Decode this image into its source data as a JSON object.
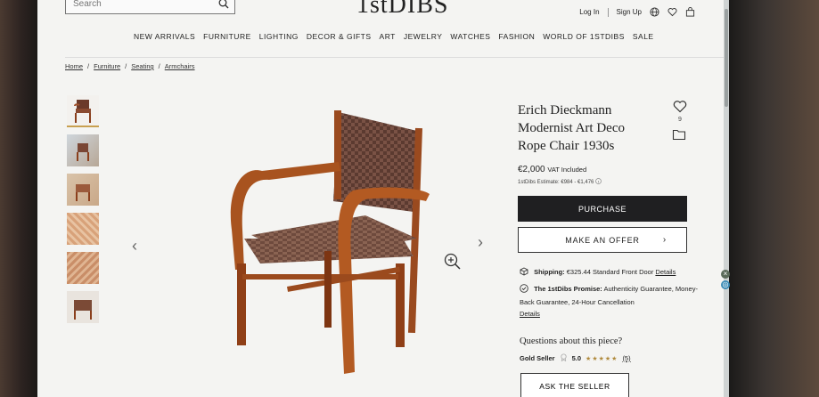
{
  "search": {
    "placeholder": "Search"
  },
  "brand": {
    "logo_main": "1stDIBS"
  },
  "top_links": {
    "login": "Log In",
    "signup": "Sign Up"
  },
  "nav": [
    "NEW ARRIVALS",
    "FURNITURE",
    "LIGHTING",
    "DECOR & GIFTS",
    "ART",
    "JEWELRY",
    "WATCHES",
    "FASHION",
    "WORLD OF 1STDIBS",
    "SALE"
  ],
  "breadcrumb": [
    "Home",
    "Furniture",
    "Seating",
    "Armchairs"
  ],
  "breadcrumb_sep": "/",
  "product": {
    "title_line1": "Erich Dieckmann",
    "title_line2": "Modernist Art Deco",
    "title_line3": "Rope Chair 1930s",
    "favorites_count": "9",
    "price": "€2,000",
    "vat": "VAT Included",
    "estimate_label": "1stDibs Estimate:",
    "estimate_range": "€984 - €1,476",
    "purchase_label": "PURCHASE",
    "offer_label": "MAKE AN OFFER",
    "offer_chevron": "›"
  },
  "shipping": {
    "label": "Shipping:",
    "value": "€325.44 Standard Front Door",
    "link": "Details"
  },
  "promise": {
    "label": "The 1stDibs Promise:",
    "text": "Authenticity Guarantee, Money-Back Guarantee, 24-Hour Cancellation",
    "link": "Details"
  },
  "questions": "Questions about this piece?",
  "seller": {
    "tier": "Gold Seller",
    "rating": "5.0",
    "stars": "★★★★★",
    "reviews": "(5)"
  },
  "ask_label": "ASK THE SELLER",
  "gallery": {
    "prev": "‹",
    "next": "›"
  },
  "colors": {
    "purchase_bg": "#1f1f21",
    "star": "#b08a3c",
    "screen_bg": "#f4f4f2"
  }
}
